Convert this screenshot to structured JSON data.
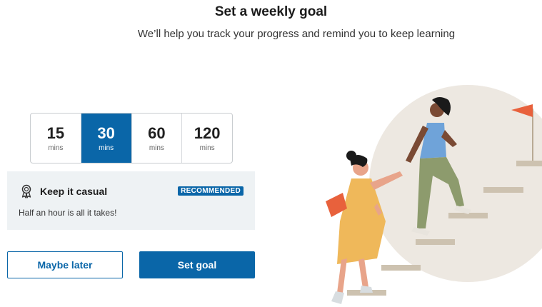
{
  "header": {
    "title": "Set a weekly goal",
    "subtitle": "We’ll help you track your progress and remind you to keep learning"
  },
  "goal_options": [
    {
      "value": "15",
      "unit": "mins",
      "selected": false
    },
    {
      "value": "30",
      "unit": "mins",
      "selected": true
    },
    {
      "value": "60",
      "unit": "mins",
      "selected": false
    },
    {
      "value": "120",
      "unit": "mins",
      "selected": false
    }
  ],
  "info_panel": {
    "icon": "award-ribbon-icon",
    "heading": "Keep it casual",
    "badge": "RECOMMENDED",
    "description": "Half an hour is all it takes!"
  },
  "actions": {
    "secondary_label": "Maybe later",
    "primary_label": "Set goal"
  },
  "colors": {
    "accent": "#0a66a8",
    "panel_bg": "#eef2f4",
    "flag": "#e8613c"
  }
}
